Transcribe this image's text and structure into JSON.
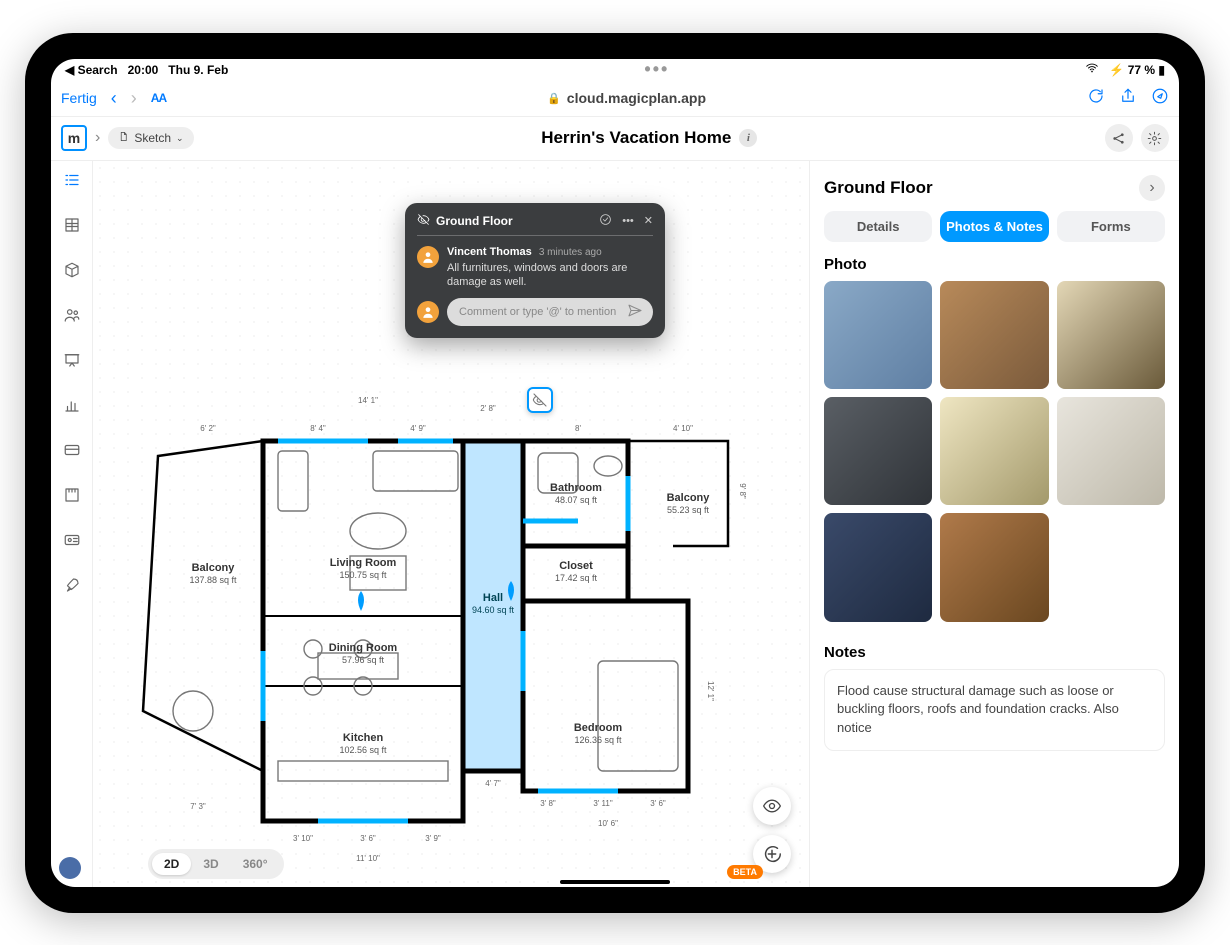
{
  "status": {
    "back_label": "Search",
    "time": "20:00",
    "date": "Thu 9. Feb",
    "battery": "77 %"
  },
  "browser": {
    "done": "Fertig",
    "text_size": "AA",
    "url": "cloud.magicplan.app"
  },
  "app": {
    "sketch_label": "Sketch",
    "title": "Herrin's Vacation Home"
  },
  "view_modes": {
    "v2d": "2D",
    "v3d": "3D",
    "v360": "360°"
  },
  "comment": {
    "title": "Ground Floor",
    "author": "Vincent Thomas",
    "time": "3 minutes ago",
    "body": "All furnitures, windows and doors are damage as well.",
    "placeholder": "Comment or type '@' to mention"
  },
  "panel": {
    "title": "Ground Floor",
    "tabs": {
      "details": "Details",
      "photos": "Photos & Notes",
      "forms": "Forms"
    },
    "photo_heading": "Photo",
    "notes_heading": "Notes",
    "notes_body": "Flood cause structural damage such as loose or buckling floors, roofs and foundation cracks. Also notice"
  },
  "beta": "BETA",
  "rooms": {
    "balcony_left": {
      "name": "Balcony",
      "area": "137.88 sq ft"
    },
    "living": {
      "name": "Living Room",
      "area": "150.75 sq ft"
    },
    "dining": {
      "name": "Dining Room",
      "area": "57.96 sq ft"
    },
    "kitchen": {
      "name": "Kitchen",
      "area": "102.56 sq ft"
    },
    "hall": {
      "name": "Hall",
      "area": "94.60 sq ft"
    },
    "bathroom": {
      "name": "Bathroom",
      "area": "48.07 sq ft"
    },
    "closet": {
      "name": "Closet",
      "area": "17.42 sq ft"
    },
    "bedroom": {
      "name": "Bedroom",
      "area": "126.36 sq ft"
    },
    "balcony_right": {
      "name": "Balcony",
      "area": "55.23 sq ft"
    }
  },
  "dims": {
    "top_overall": "14' 1\"",
    "living_top": "8' 4\"",
    "living_top2": "4' 9\"",
    "entry": "2' 8\"",
    "bath_top": "8'",
    "balc_r_top": "4' 10\"",
    "left_balc": "6' 2\"",
    "bedroom_row": "3' 8\"",
    "bedroom_row2": "3' 11\"",
    "bedroom_row3": "3' 6\"",
    "bedroom_bot": "10' 6\"",
    "kitchen_row1": "3' 10\"",
    "kitchen_row2": "3' 6\"",
    "kitchen_row3": "3' 9\"",
    "kitchen_bot": "11' 10\"",
    "hall_bot": "4' 7\"",
    "bl_left": "7' 3\"",
    "right_h1": "9' 8\"",
    "right_h2": "12' 1\""
  }
}
